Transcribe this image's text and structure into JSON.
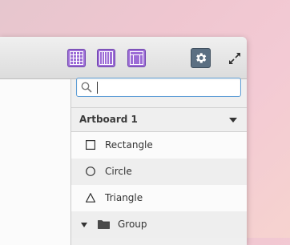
{
  "toolbar": {
    "icons": [
      "grid-icon",
      "columns-icon",
      "layout-icon",
      "gear-icon",
      "expand-icon"
    ],
    "accent": "#9c6cd6",
    "gear_color": "#5b6f82"
  },
  "search": {
    "value": "",
    "placeholder": ""
  },
  "artboard": {
    "title": "Artboard 1"
  },
  "layers": [
    {
      "label": "Rectangle",
      "icon": "square-icon"
    },
    {
      "label": "Circle",
      "icon": "circle-icon"
    },
    {
      "label": "Triangle",
      "icon": "triangle-icon"
    },
    {
      "label": "Group",
      "icon": "folder-icon"
    }
  ]
}
